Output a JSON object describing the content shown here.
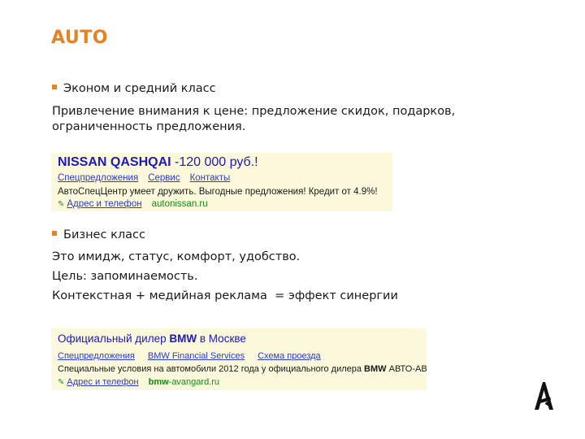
{
  "slide": {
    "title": "AUTO"
  },
  "section1": {
    "bullet": "Эконом и средний класс",
    "line1": "Привлечение внимания к цене: предложение скидок, подарков,",
    "line2": "ограниченность предложения."
  },
  "ad1": {
    "title_bold": "NISSAN QASHQAI",
    "title_rest": " -120 000 руб.!",
    "links": [
      "Спецпредложения",
      "Сервис",
      "Контакты"
    ],
    "description": "АвтоСпецЦентр умеет дружить. Выгодные предложения! Кредит от 4.9%!",
    "address_link": "Адрес и телефон",
    "domain": "autonissan.ru"
  },
  "section2": {
    "bullet": "Бизнес класс",
    "line1": "Это имидж, статус, комфорт, удобство.",
    "line2": "Цель: запоминаемость.",
    "line3": "Контекстная + медийная реклама  = эффект синергии"
  },
  "ad2": {
    "title_pre": "Официальный дилер ",
    "title_bold": "BMW",
    "title_post": " в Москве",
    "links": [
      "Спецпредложения",
      "BMW Financial Services",
      "Схема проезда"
    ],
    "description_pre": "Специальные условия на автомобили 2012 года у официального дилера ",
    "description_bold": "BMW",
    "description_post": " АВТО-АВАНГАРД",
    "address_link": "Адрес и телефон",
    "domain_bold": "bmw",
    "domain_rest": "-avangard.ru"
  },
  "colors": {
    "accent": "#e8821e",
    "ad_background": "#fbf8dc",
    "ad_link": "#2a3ccd",
    "ad_domain": "#178a17"
  },
  "icons": {
    "logo": "company-logo-icon",
    "bullet": "square-bullet-icon",
    "pin": "pencil-pin-icon"
  }
}
